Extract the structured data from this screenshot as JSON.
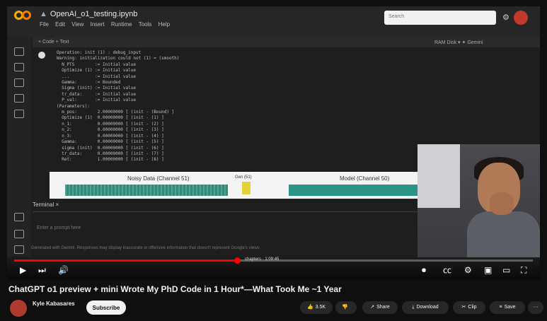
{
  "notebook": {
    "title": "OpenAI_o1_testing.ipynb",
    "menu": [
      "File",
      "Edit",
      "View",
      "Insert",
      "Runtime",
      "Tools",
      "Help"
    ],
    "search_placeholder": "Search",
    "toolbar_left": "+ Code  + Text",
    "toolbar_right": "RAM  Disk   ▾   ✦ Gemini",
    "code_lines": [
      "Operation: init (1) : debug_input",
      "Warning: initialization could not (1) = (smooth)",
      "  N_PTS        := Initial value",
      "  Optimize (1) := Initial value",
      "  ...          := Initial value",
      "  Gamma:       := Bounded",
      "  Sigma (init) := Initial value",
      "  tr_data:     := Initial value",
      "  P_val:       := Initial value",
      "(Parameters):",
      "  m_pos:        2.00000000 [ (init - (Bound) ]",
      "  Optimize (1)  0.00000000 [ (init - (1) ]",
      "  n_1:          0.00000000 [ (init - (2) ]",
      "  n_2:          0.00000000 [ (init - (3) ]",
      "  n_3:          0.00000000 [ (init - (4) ]",
      "  Gamma:        0.00000000 [ (init - (5) ]",
      "  sigma (init)  0.00000000 [ (init - (6) ]",
      "  tr_data:      0.00000000 [ (init - (7) ]",
      "  Ret:          1.00000000 [ (init - (8) ]"
    ],
    "plot_left_label": "Noisy Data (Channel 51)",
    "plot_mid_label": "Gen (51)",
    "plot_right_label": "Model (Channel 50)",
    "terminal_tab": "Terminal  ×",
    "terminal_prompt": "Enter a prompt here",
    "status_line": "Generated with Gemini. Responses may display inaccurate or offensive information that doesn't represent Google's views"
  },
  "video": {
    "progress_fraction": 0.43,
    "chapter": "chapters · 1:09:45"
  },
  "info": {
    "title": "ChatGPT o1 preview + mini Wrote My PhD Code in 1 Hour*—What Took Me ~1 Year",
    "channel_name": "Kyle Kabasares",
    "channel_subs": "",
    "subscribe_label": "Subscribe",
    "likes": "3.5K",
    "share_label": "Share",
    "download_label": "Download",
    "clip_label": "Clip",
    "save_label": "Save",
    "more_label": "···"
  },
  "colors": {
    "accent": "#ff0000",
    "plot_teal": "#2f8c7c",
    "plot_yellow": "#e4d23a",
    "colab_orange": "#f9ab00"
  },
  "icons": [
    "colab-logo-icon",
    "drive-icon",
    "gear-icon",
    "play-icon",
    "next-icon",
    "volume-icon",
    "cc-icon",
    "settings-icon",
    "miniplayer-icon",
    "theater-icon",
    "fullscreen-icon",
    "like-icon",
    "dislike-icon",
    "share-icon",
    "download-icon",
    "clip-icon",
    "save-icon"
  ]
}
